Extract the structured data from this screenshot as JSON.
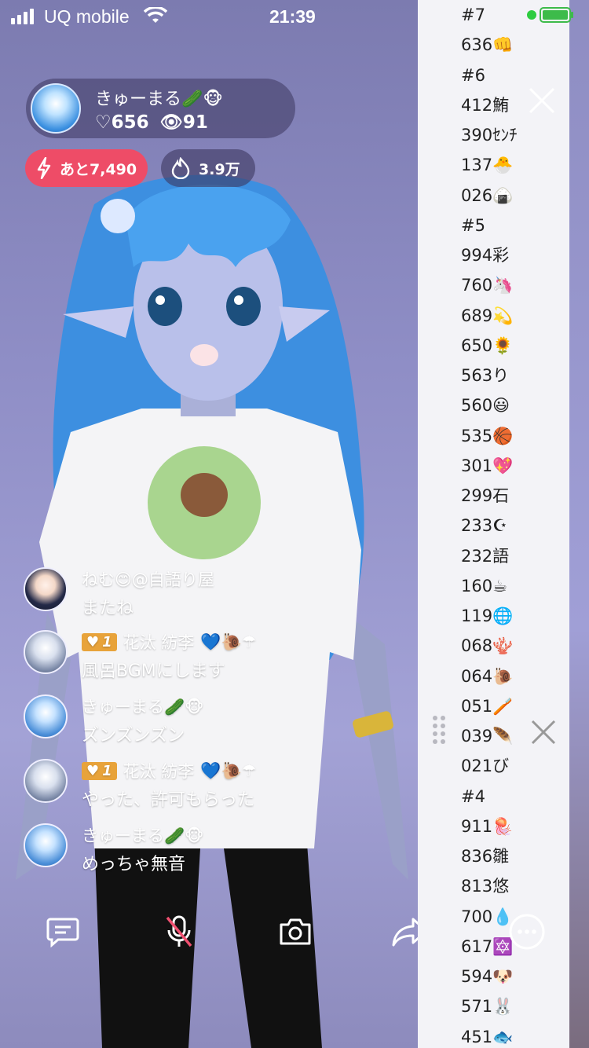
{
  "status": {
    "carrier": "UQ mobile",
    "time": "21:39"
  },
  "host": {
    "name": "きゅーまる🥒🐵",
    "likes": "♡656",
    "viewers": "91"
  },
  "badges": {
    "remaining": "あと7,490",
    "popularity": "3.9万"
  },
  "comments": [
    {
      "name": "ねむ😊@自語り屋",
      "level": "",
      "message": "またね",
      "avatar": "dark",
      "icons": ""
    },
    {
      "name": "花汰 紡李",
      "level": "1",
      "message": "風呂BGMにします",
      "avatar": "grey",
      "icons": "💙🐌☂"
    },
    {
      "name": "きゅーまる🥒🐵",
      "level": "",
      "message": "ズンズンズン",
      "avatar": "blue",
      "icons": ""
    },
    {
      "name": "花汰 紡李",
      "level": "1",
      "message": "やった、許可もらった",
      "avatar": "grey",
      "icons": "💙🐌☂"
    },
    {
      "name": "きゅーまる🥒🐵",
      "level": "",
      "message": "めっちゃ無音",
      "avatar": "blue",
      "icons": ""
    }
  ],
  "bottom_bar": [
    "comment-icon",
    "mic-muted-icon",
    "camera-icon",
    "share-icon",
    "more-icon"
  ],
  "ranking": [
    "#7",
    "636👊",
    "#6",
    "412鮪",
    "390ｾﾝﾁ",
    "137🐣",
    "026🍙",
    "#5",
    "994彩",
    "760🦄",
    "689💫",
    "650🌻",
    "563り",
    "560😃",
    "535🏀",
    "301💖",
    "299石",
    "233☪",
    "232語",
    "160☕",
    "119🌐",
    "068🪸",
    "064🐌",
    "051🪥",
    "039🪶",
    "021び",
    "#4",
    "911🪼",
    "836雛",
    "813悠",
    "700💧",
    "617🔯",
    "594🐶",
    "571🐰",
    "451🐟"
  ]
}
